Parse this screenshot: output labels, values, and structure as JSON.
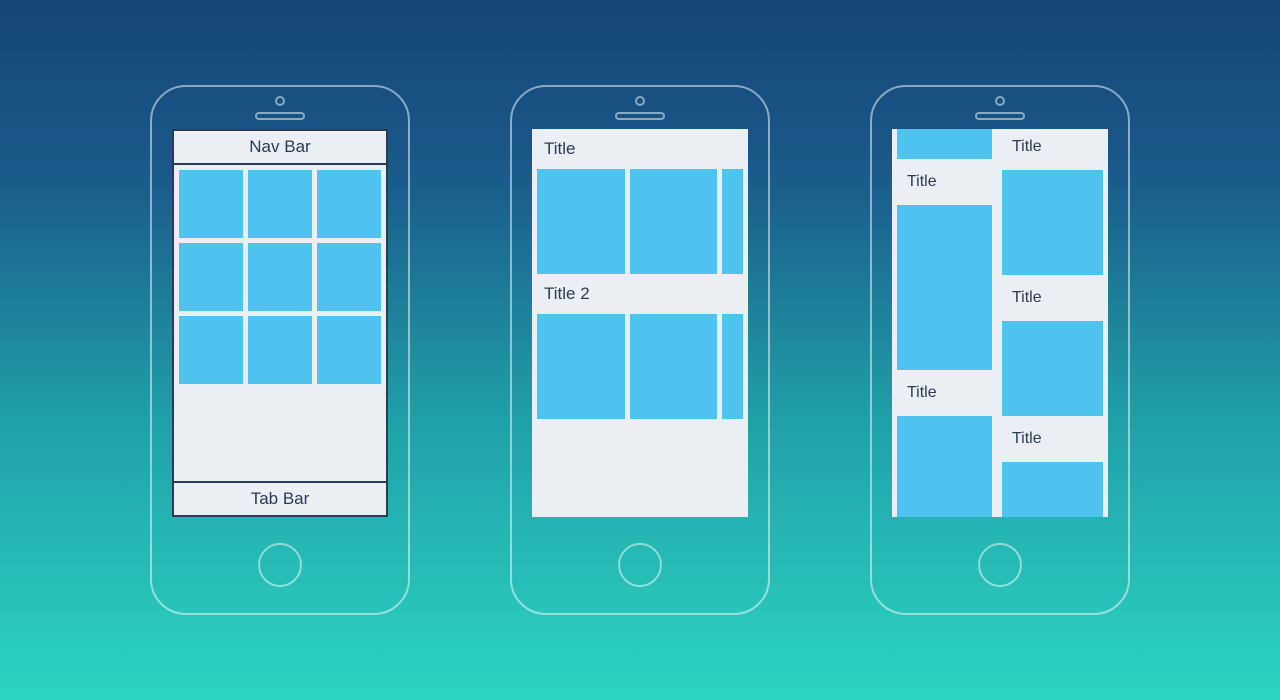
{
  "phone1": {
    "navbar_label": "Nav Bar",
    "tabbar_label": "Tab Bar"
  },
  "phone2": {
    "section1_title": "Title",
    "section2_title": "Title 2"
  },
  "phone3": {
    "titles": [
      "Title",
      "Title",
      "Title",
      "Title",
      "Title"
    ]
  },
  "colors": {
    "tile": "#4fc3f0",
    "surface": "#ebeef3",
    "text": "#2a3b55"
  }
}
